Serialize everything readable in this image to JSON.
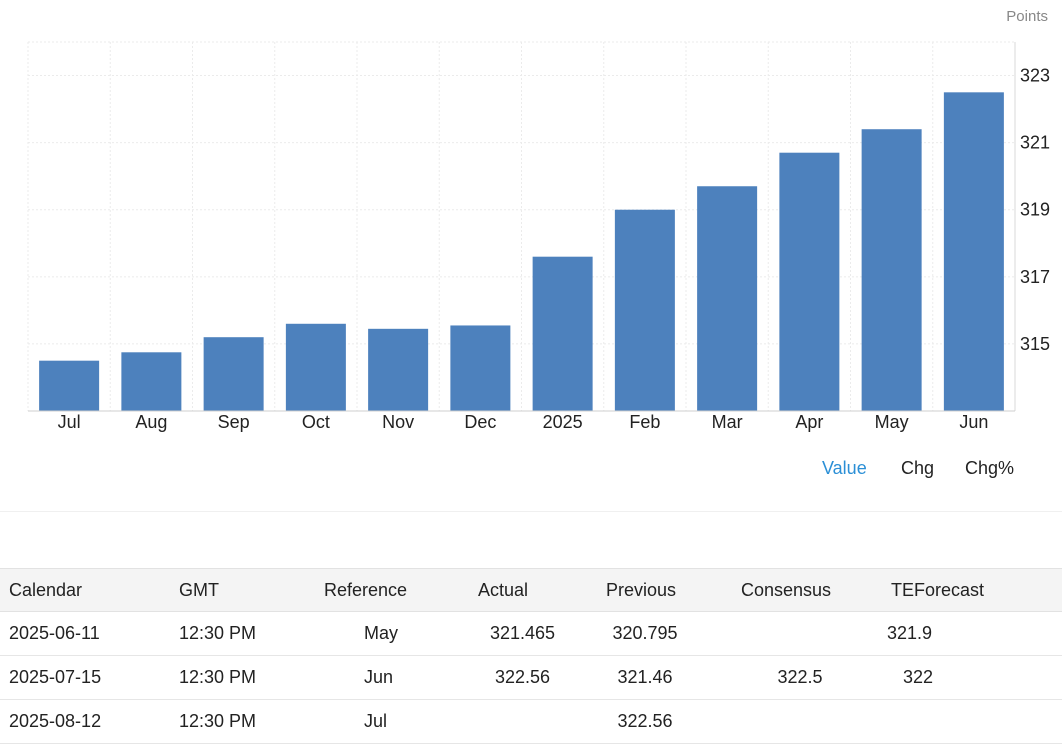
{
  "unit_label": "Points",
  "chart_data": {
    "type": "bar",
    "categories": [
      "Jul",
      "Aug",
      "Sep",
      "Oct",
      "Nov",
      "Dec",
      "2025",
      "Feb",
      "Mar",
      "Apr",
      "May",
      "Jun"
    ],
    "values": [
      314.5,
      314.75,
      315.2,
      315.6,
      315.45,
      315.55,
      317.6,
      319.0,
      319.7,
      320.7,
      321.4,
      322.5
    ],
    "yticks": [
      315,
      317,
      319,
      321,
      323
    ],
    "ylim": [
      313.0,
      324.0
    ],
    "grid": true,
    "bar_color": "#4d81bd",
    "xlabel": "",
    "ylabel": ""
  },
  "toggles": [
    {
      "label": "Value",
      "active": true
    },
    {
      "label": "Chg",
      "active": false
    },
    {
      "label": "Chg%",
      "active": false
    }
  ],
  "table": {
    "headers": [
      "Calendar",
      "GMT",
      "Reference",
      "Actual",
      "Previous",
      "Consensus",
      "TEForecast"
    ],
    "rows": [
      [
        "2025-06-11",
        "12:30 PM",
        "May",
        "321.465",
        "320.795",
        "",
        "321.9"
      ],
      [
        "2025-07-15",
        "12:30 PM",
        "Jun",
        "322.56",
        "321.46",
        "322.5",
        "322"
      ],
      [
        "2025-08-12",
        "12:30 PM",
        "Jul",
        "",
        "322.56",
        "",
        ""
      ]
    ]
  },
  "colors": {
    "accent": "#2b8fd6",
    "bar": "#4d81bd",
    "grid": "#ebebeb"
  }
}
